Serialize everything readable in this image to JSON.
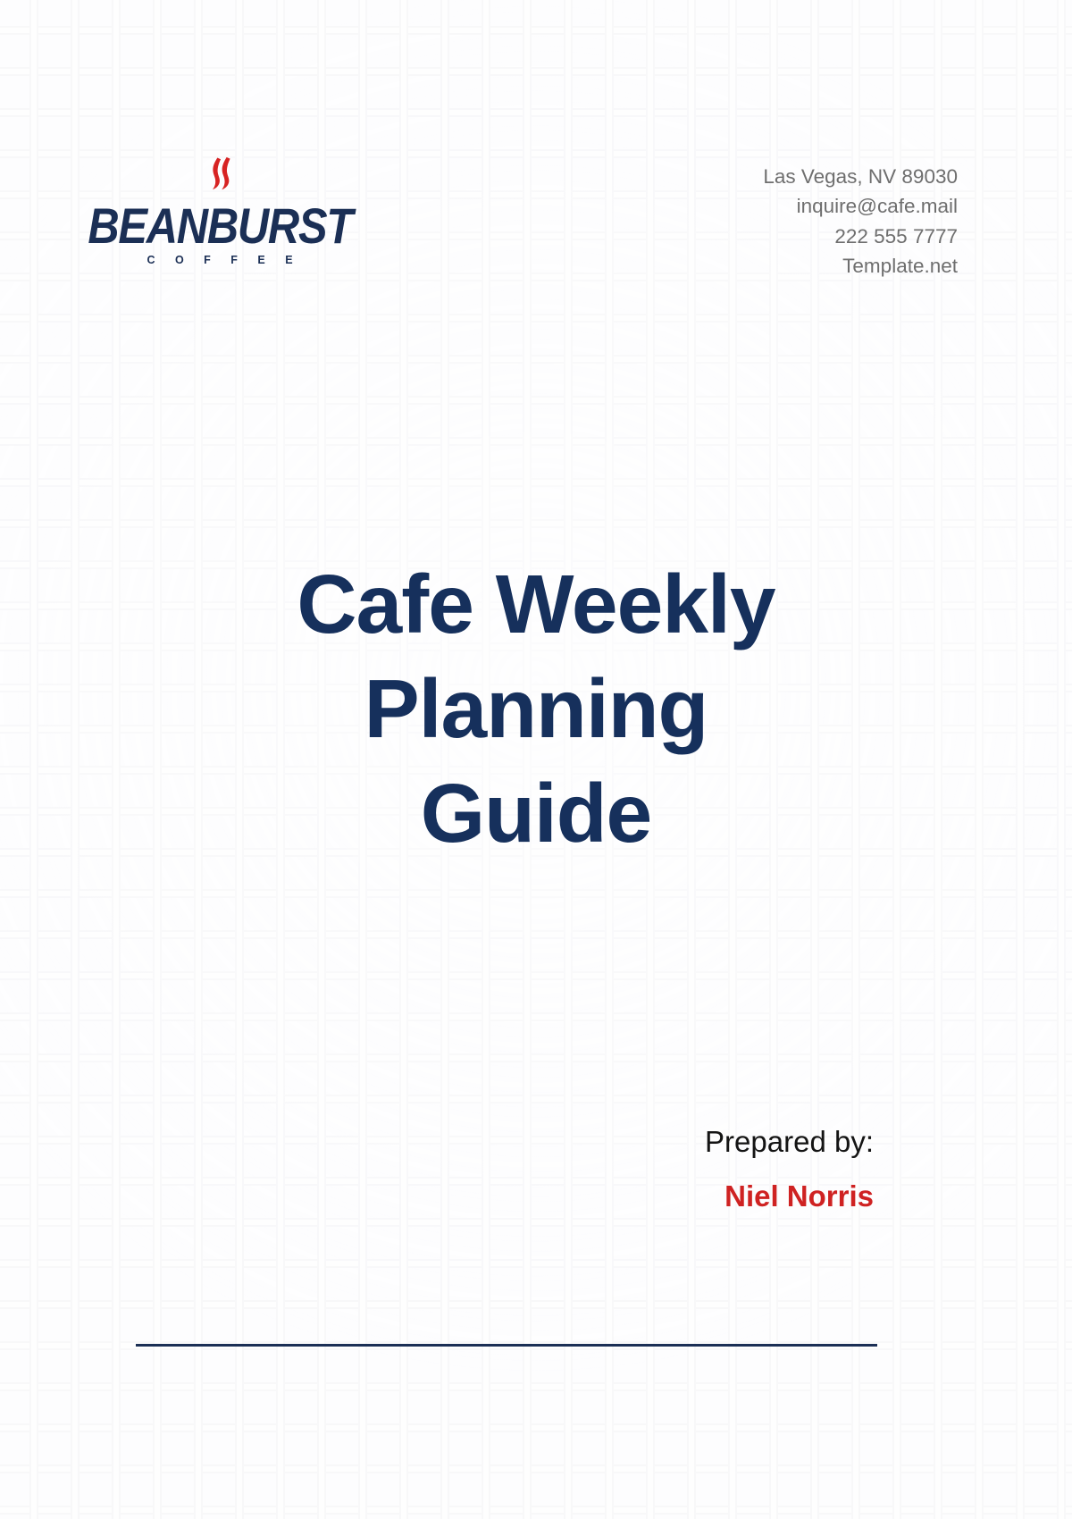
{
  "document": {
    "type": "cover-page",
    "title": "Cafe Weekly Planning Guide",
    "accent_navy": "#16305c",
    "accent_red": "#cf2222",
    "background": "#fdfdfe"
  },
  "logo": {
    "mark": "coffee-steam-flame-icon",
    "mark_color": "#d72323",
    "wordmark": "BEANBURST",
    "subtitle": "C O F F E E",
    "wordmark_color": "#1b2f55"
  },
  "contact": {
    "address": "Las Vegas, NV 89030",
    "email": "inquire@cafe.mail",
    "phone": "222 555 7777",
    "website": "Template.net"
  },
  "title": {
    "line1": "Cafe Weekly",
    "line2": "Planning",
    "line3": "Guide",
    "full": "Cafe Weekly Planning Guide"
  },
  "prepared_by": {
    "label": "Prepared by:",
    "name": "Niel Norris"
  }
}
